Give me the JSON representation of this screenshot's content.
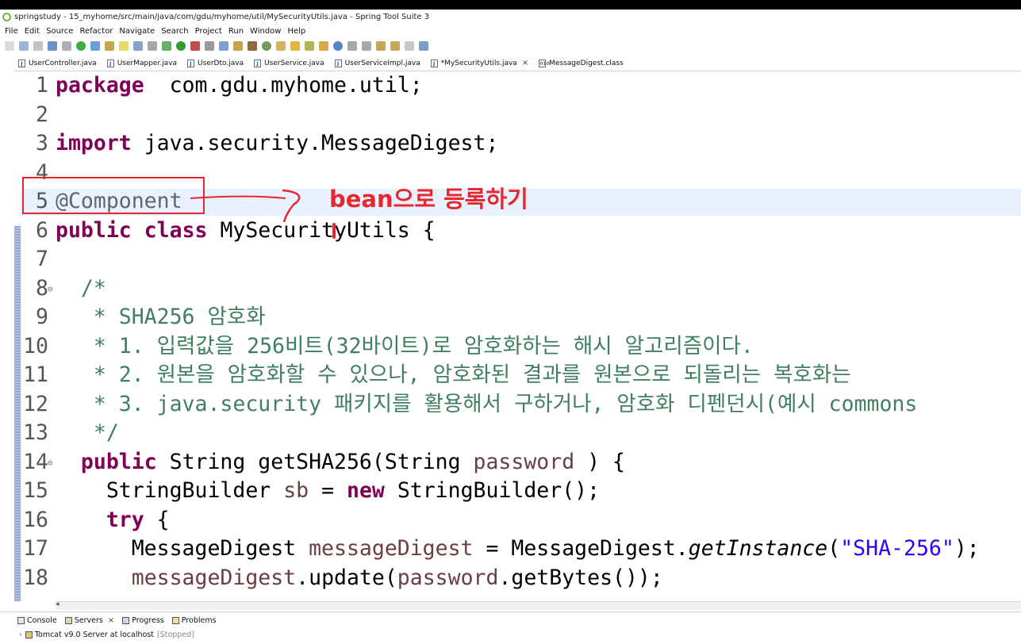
{
  "window": {
    "title": "springstudy - 15_myhome/src/main/java/com/gdu/myhome/util/MySecurityUtils.java - Spring Tool Suite 3"
  },
  "menu": [
    "File",
    "Edit",
    "Source",
    "Refactor",
    "Navigate",
    "Search",
    "Project",
    "Run",
    "Window",
    "Help"
  ],
  "tabs": [
    {
      "label": "UserController.java",
      "active": false
    },
    {
      "label": "UserMapper.java",
      "active": false
    },
    {
      "label": "UserDto.java",
      "active": false
    },
    {
      "label": "UserService.java",
      "active": false
    },
    {
      "label": "UserServiceImpl.java",
      "active": false
    },
    {
      "label": "*MySecurityUtils.java",
      "active": true,
      "close": "×"
    },
    {
      "label": "MessageDigest.class",
      "active": false
    }
  ],
  "code": {
    "lines": [
      {
        "num": "1",
        "parts": [
          [
            "kw",
            "package"
          ],
          [
            "",
            "  com.gdu.myhome.util;"
          ]
        ]
      },
      {
        "num": "2",
        "parts": []
      },
      {
        "num": "3",
        "parts": [
          [
            "kw",
            "import"
          ],
          [
            "",
            " java.security.MessageDigest;"
          ]
        ]
      },
      {
        "num": "4",
        "parts": []
      },
      {
        "num": "5",
        "parts": [
          [
            "ann",
            "@Component"
          ]
        ]
      },
      {
        "num": "6",
        "parts": [
          [
            "kw",
            "public"
          ],
          [
            "",
            " "
          ],
          [
            "kw",
            "class"
          ],
          [
            "",
            " MySecurityUtils {"
          ]
        ]
      },
      {
        "num": "7",
        "parts": []
      },
      {
        "num": "8",
        "fold": "⊖",
        "parts": [
          [
            "cm",
            "  /*"
          ]
        ]
      },
      {
        "num": "9",
        "parts": [
          [
            "cm",
            "   * SHA256 암호화"
          ]
        ]
      },
      {
        "num": "10",
        "parts": [
          [
            "cm",
            "   * 1. 입력값을 256비트(32바이트)로 암호화하는 해시 알고리즘이다."
          ]
        ]
      },
      {
        "num": "11",
        "parts": [
          [
            "cm",
            "   * 2. 원본을 암호화할 수 있으나, 암호화된 결과를 원본으로 되돌리는 복호화는"
          ]
        ]
      },
      {
        "num": "12",
        "parts": [
          [
            "cm",
            "   * 3. java.security 패키지를 활용해서 구하거나, 암호화 디펜던시(예시 commons"
          ]
        ]
      },
      {
        "num": "13",
        "parts": [
          [
            "cm",
            "   */"
          ]
        ]
      },
      {
        "num": "14",
        "fold": "⊖",
        "parts": [
          [
            "",
            "  "
          ],
          [
            "kw",
            "public"
          ],
          [
            "",
            " String getSHA256(String "
          ],
          [
            "var",
            "password"
          ],
          [
            "",
            " ) {"
          ]
        ]
      },
      {
        "num": "15",
        "parts": [
          [
            "",
            "    StringBuilder "
          ],
          [
            "var",
            "sb"
          ],
          [
            "",
            " = "
          ],
          [
            "kw",
            "new"
          ],
          [
            "",
            " StringBuilder();"
          ]
        ]
      },
      {
        "num": "16",
        "parts": [
          [
            "",
            "    "
          ],
          [
            "kw",
            "try"
          ],
          [
            "",
            " {"
          ]
        ]
      },
      {
        "num": "17",
        "parts": [
          [
            "",
            "      MessageDigest "
          ],
          [
            "var",
            "messageDigest"
          ],
          [
            "",
            " = MessageDigest."
          ],
          [
            "ital",
            "getInstance"
          ],
          [
            "",
            "("
          ],
          [
            "str",
            "\"SHA-256\""
          ],
          [
            "",
            ");"
          ]
        ]
      },
      {
        "num": "18",
        "parts": [
          [
            "",
            "      "
          ],
          [
            "var",
            "messageDigest"
          ],
          [
            "",
            ".update("
          ],
          [
            "var",
            "password"
          ],
          [
            "",
            ".getBytes());"
          ]
        ]
      }
    ]
  },
  "annotation": {
    "text": "bean으로 등록하기"
  },
  "bottom": {
    "tabs": [
      "Console",
      "Servers",
      "Progress",
      "Problems"
    ],
    "server_name": "Tomcat v9.0 Server at localhost",
    "server_state": "[Stopped]"
  },
  "colors": {
    "annotation_red": "#e8262f",
    "keyword": "#7f0055",
    "comment": "#3f7f5f",
    "string": "#2a00ff"
  },
  "icons": [
    "spring-logo-icon",
    "java-file-icon",
    "class-file-icon",
    "console-icon",
    "servers-icon",
    "progress-icon",
    "problems-icon",
    "tomcat-server-icon"
  ]
}
